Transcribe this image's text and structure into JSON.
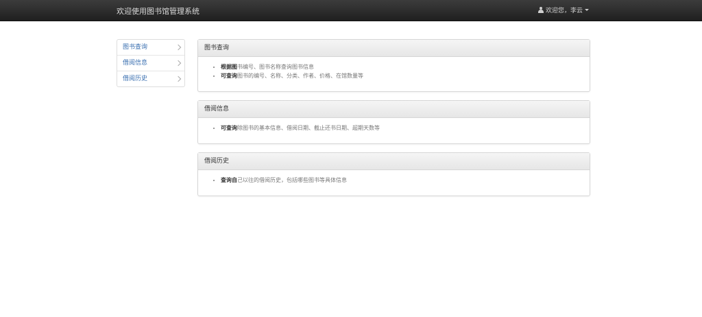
{
  "navbar": {
    "brand": "欢迎使用图书馆管理系统",
    "user_label": "欢迎您，李云"
  },
  "sidebar": {
    "items": [
      {
        "label": "图书查询"
      },
      {
        "label": "借阅信息"
      },
      {
        "label": "借阅历史"
      }
    ]
  },
  "panels": [
    {
      "title": "图书查询",
      "items": [
        {
          "bold": "根据图",
          "text": "书编号、图书名称查询图书信息"
        },
        {
          "bold": "可查询",
          "text": "图书的编号、名称、分类、作者、价格、在馆数量等"
        }
      ]
    },
    {
      "title": "借阅信息",
      "items": [
        {
          "bold": "可查询",
          "text": "除图书的基本信息、借阅日期、截止还书日期、超期天数等"
        }
      ]
    },
    {
      "title": "借阅历史",
      "items": [
        {
          "bold": "查询自",
          "text": "己以往的借阅历史，包括哪些图书等具体信息"
        }
      ]
    }
  ]
}
